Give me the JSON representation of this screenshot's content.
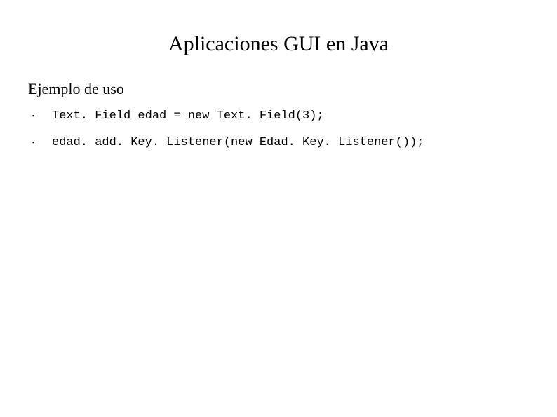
{
  "title": "Aplicaciones GUI en Java",
  "subtitle": "Ejemplo de uso",
  "bullets": [
    "Text. Field edad = new Text. Field(3);",
    "edad. add. Key. Listener(new Edad. Key. Listener());"
  ]
}
